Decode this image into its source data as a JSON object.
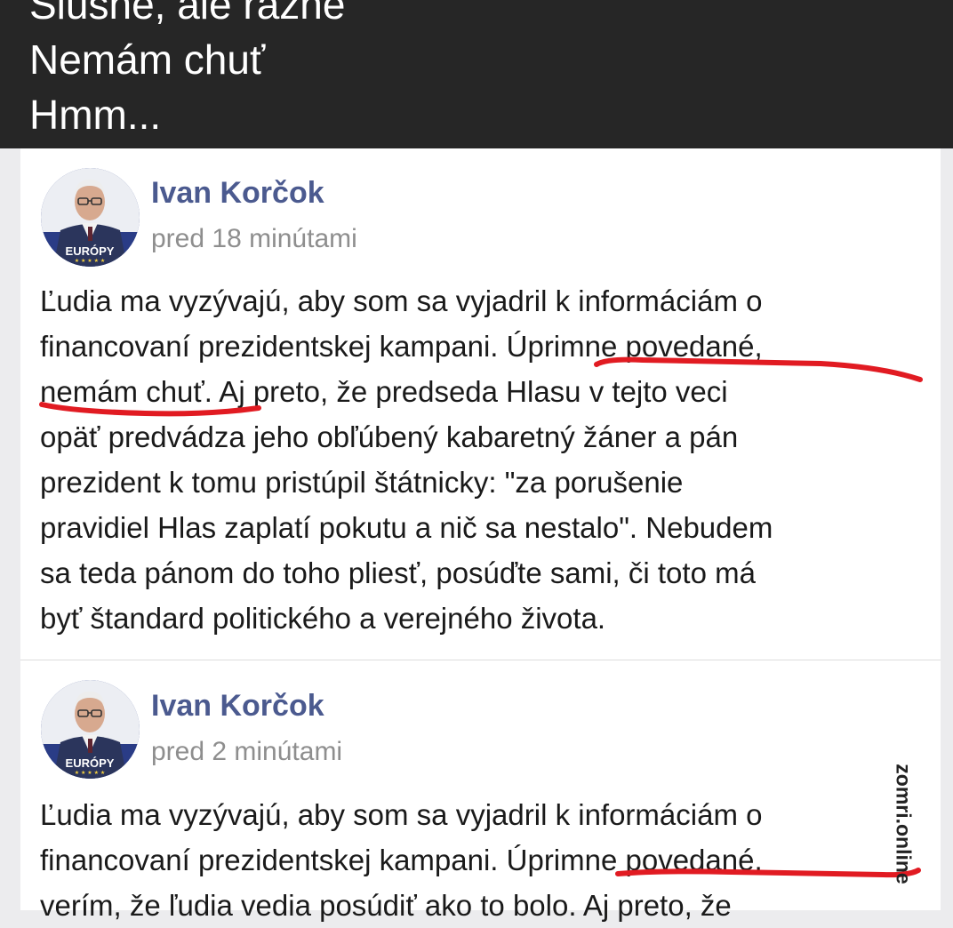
{
  "caption": {
    "lines": [
      "Slušne, ale rázne",
      "Nemám chuť",
      "Hmm..."
    ]
  },
  "posts": [
    {
      "author": "Ivan Korčok",
      "time": "pred 18 minútami",
      "avatar_label": "EURÓPY",
      "body_lines": [
        "Ľudia ma vyzývajú, aby som sa vyjadril k informáciám o",
        "financovaní prezidentskej kampani. Úprimne povedané,",
        "nemám chuť. Aj preto, že predseda Hlasu v tejto veci",
        "opäť predvádza jeho obľúbený kabaretný žáner a pán",
        "prezident k tomu pristúpil štátnicky: \"za porušenie",
        "pravidiel Hlas zaplatí pokutu a nič sa nestalo\". Nebudem",
        "sa teda pánom do toho pliesť, posúďte sami, či toto má",
        "byť štandard politického a verejného života."
      ]
    },
    {
      "author": "Ivan Korčok",
      "time": "pred 2 minútami",
      "avatar_label": "EURÓPY",
      "body_lines": [
        "Ľudia ma vyzývajú, aby som sa vyjadril k informáciám o",
        "financovaní prezidentskej kampani. Úprimne povedané,",
        "verím, že ľudia vedia posúdiť ako to bolo. Aj preto, že"
      ]
    }
  ],
  "watermark": "zomri.online",
  "colors": {
    "caption_band": "#262626",
    "author": "#4b5a8f",
    "underline": "#e11b22",
    "avatar_bg": "#2a3c86"
  }
}
